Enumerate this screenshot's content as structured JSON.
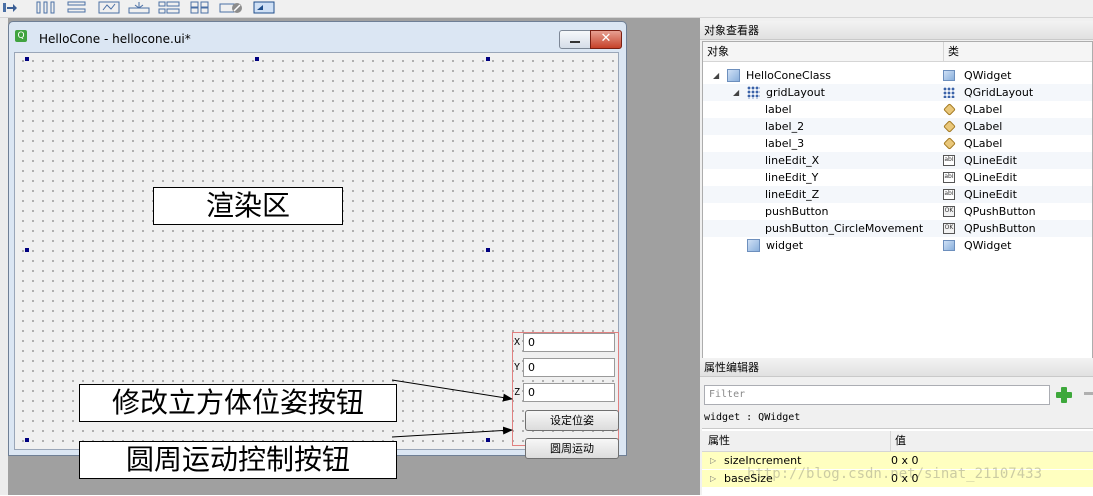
{
  "window": {
    "title": "HelloCone - hellocone.ui*",
    "title_icon": "Q",
    "close_glyph": "✕"
  },
  "form": {
    "annotation_render_area": "渲染区",
    "annotation_set_pose": "修改立方体位姿按钮",
    "annotation_circle": "圆周运动控制按钮",
    "axis_x": "X",
    "axis_y": "Y",
    "axis_z": "Z",
    "edit_x_value": "0",
    "edit_y_value": "0",
    "edit_z_value": "0",
    "set_pose_button": "设定位姿",
    "circle_button": "圆周运动"
  },
  "object_inspector": {
    "title": "对象查看器",
    "col_object": "对象",
    "col_class": "类",
    "rows": [
      {
        "name": "HelloConeClass",
        "cls": "QWidget"
      },
      {
        "name": "gridLayout",
        "cls": "QGridLayout"
      },
      {
        "name": "label",
        "cls": "QLabel"
      },
      {
        "name": "label_2",
        "cls": "QLabel"
      },
      {
        "name": "label_3",
        "cls": "QLabel"
      },
      {
        "name": "lineEdit_X",
        "cls": "QLineEdit"
      },
      {
        "name": "lineEdit_Y",
        "cls": "QLineEdit"
      },
      {
        "name": "lineEdit_Z",
        "cls": "QLineEdit"
      },
      {
        "name": "pushButton",
        "cls": "QPushButton"
      },
      {
        "name": "pushButton_CircleMovement",
        "cls": "QPushButton"
      },
      {
        "name": "widget",
        "cls": "QWidget"
      }
    ],
    "edit_icon_text": "abI",
    "button_icon_text": "OK"
  },
  "property_editor": {
    "title": "属性编辑器",
    "filter_placeholder": "Filter",
    "object_caption": "widget : QWidget",
    "col_property": "属性",
    "col_value": "值",
    "rows": [
      {
        "name": "sizeIncrement",
        "value": "0 x 0"
      },
      {
        "name": "baseSize",
        "value": "0 x 0"
      }
    ]
  },
  "watermark": "http://blog.csdn.net/sinat_21107433",
  "colors": {
    "selection_handle": "#000080",
    "highlight_row": "#ffffc0",
    "add_button": "#3ea83b",
    "close_button": "#c6422a"
  }
}
